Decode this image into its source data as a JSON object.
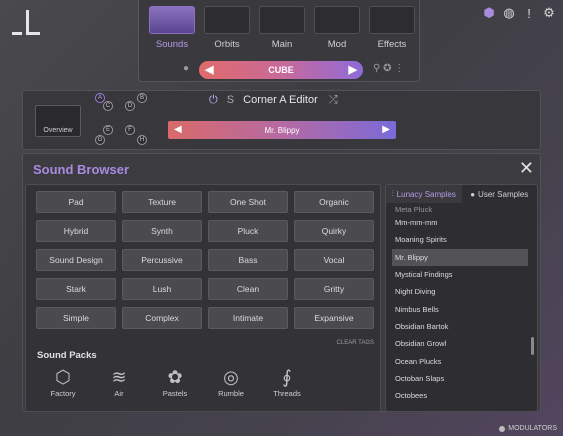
{
  "nav": {
    "tabs": [
      {
        "label": "Sounds",
        "active": true
      },
      {
        "label": "Orbits",
        "active": false
      },
      {
        "label": "Main",
        "active": false
      },
      {
        "label": "Mod",
        "active": false
      },
      {
        "label": "Effects",
        "active": false
      }
    ],
    "preset": "CUBE"
  },
  "editor": {
    "overview_label": "Overview",
    "title": "Corner A Editor",
    "s_label": "S",
    "corners": [
      "A",
      "B",
      "C",
      "D",
      "E",
      "F",
      "G",
      "H"
    ],
    "sample": "Mr. Blippy"
  },
  "browser": {
    "title": "Sound Browser",
    "tags": [
      "Pad",
      "Texture",
      "One Shot",
      "Organic",
      "Hybrid",
      "Synth",
      "Pluck",
      "Quirky",
      "Sound Design",
      "Percussive",
      "Bass",
      "Vocal",
      "Stark",
      "Lush",
      "Clean",
      "Gritty",
      "Simple",
      "Complex",
      "Intimate",
      "Expansive"
    ],
    "clear_tags": "CLEAR TAGS",
    "sound_packs_title": "Sound Packs",
    "packs": [
      {
        "label": "Factory",
        "icon": "cube-icon"
      },
      {
        "label": "Air",
        "icon": "wind-icon"
      },
      {
        "label": "Pastels",
        "icon": "flower-icon"
      },
      {
        "label": "Rumble",
        "icon": "ripple-icon"
      },
      {
        "label": "Threads",
        "icon": "thread-icon"
      }
    ],
    "sample_tabs": [
      "Lunacy Samples",
      "User Samples"
    ],
    "samples": [
      "Meta Pluck",
      "Mm-mm-mm",
      "Moaning Spirits",
      "Mr. Blippy",
      "Mystical Findings",
      "Night Diving",
      "Nimbus Bells",
      "Obsidian Bartok",
      "Obsidian Growl",
      "Ocean Plucks",
      "Octoban Slaps",
      "Octobees"
    ],
    "selected_sample": "Mr. Blippy"
  },
  "footer": {
    "modulators": "MODULATORS"
  },
  "colors": {
    "accent": "#a88be0",
    "gradient_start": "#e06b6b",
    "gradient_end": "#8e6bd8"
  }
}
